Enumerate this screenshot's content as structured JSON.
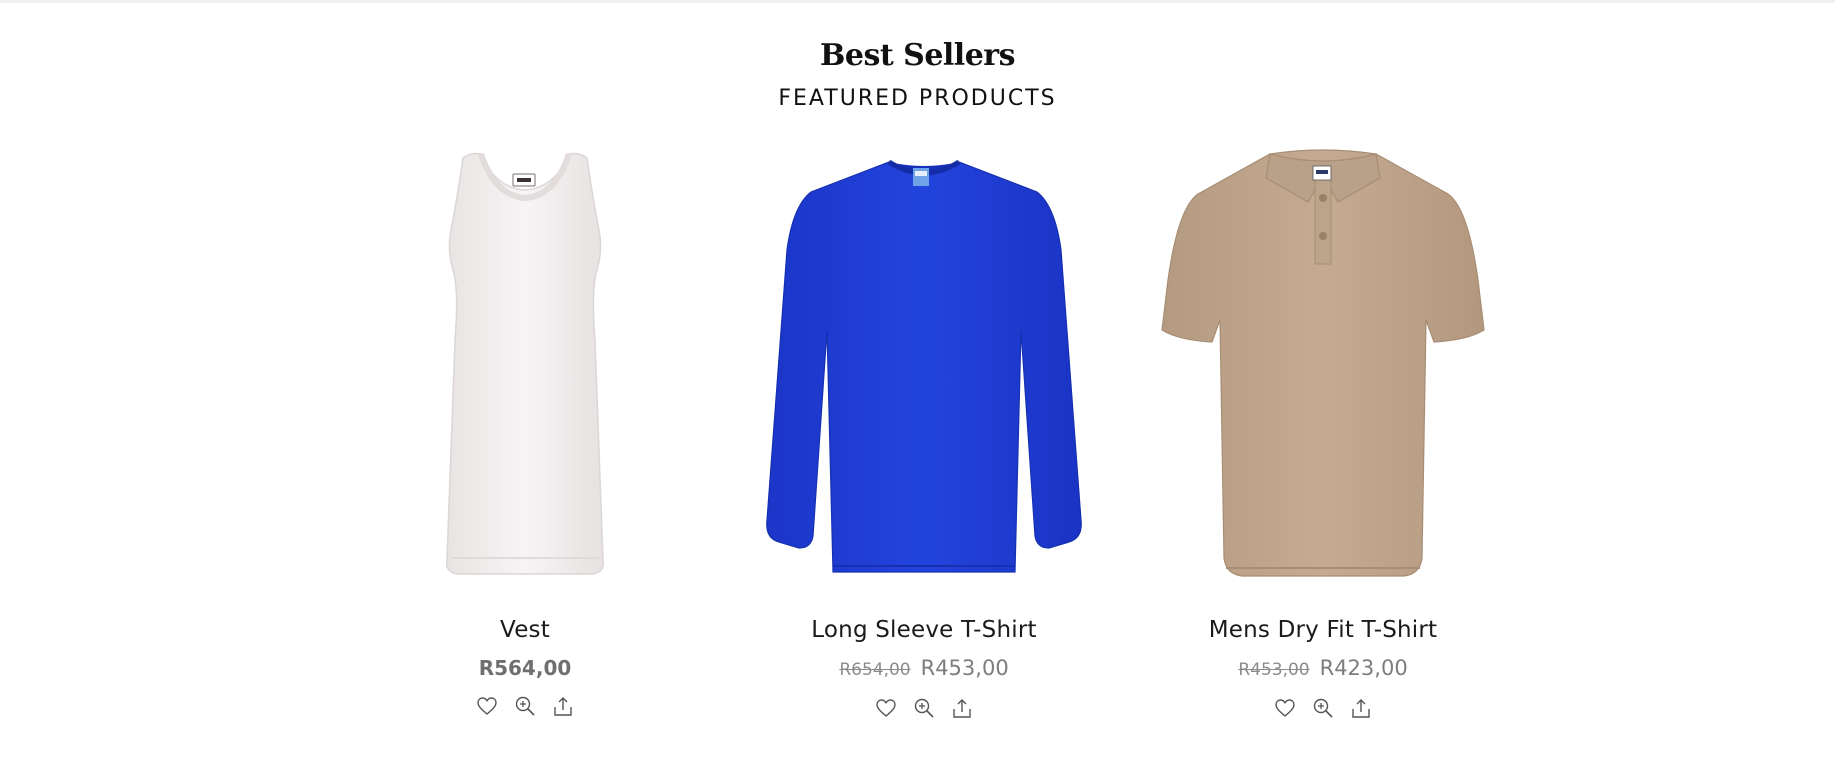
{
  "section": {
    "title": "Best Sellers",
    "subtitle": "FEATURED PRODUCTS"
  },
  "products": [
    {
      "name": "Vest",
      "price": "R564,00",
      "color": "#f3f1f1",
      "image_icon": "white-vest-image",
      "actions": [
        "heart-icon",
        "zoom-in-icon",
        "share-icon"
      ]
    },
    {
      "name": "Long Sleeve T-Shirt",
      "old_price": "R654,00",
      "price": "R453,00",
      "color": "#1f3dd4",
      "image_icon": "blue-long-sleeve-shirt-image",
      "actions": [
        "heart-icon",
        "zoom-in-icon",
        "share-icon"
      ]
    },
    {
      "name": "Mens Dry Fit T-Shirt",
      "old_price": "R453,00",
      "price": "R423,00",
      "color": "#bfa58c",
      "image_icon": "beige-polo-shirt-image",
      "actions": [
        "heart-icon",
        "zoom-in-icon",
        "share-icon"
      ]
    }
  ]
}
